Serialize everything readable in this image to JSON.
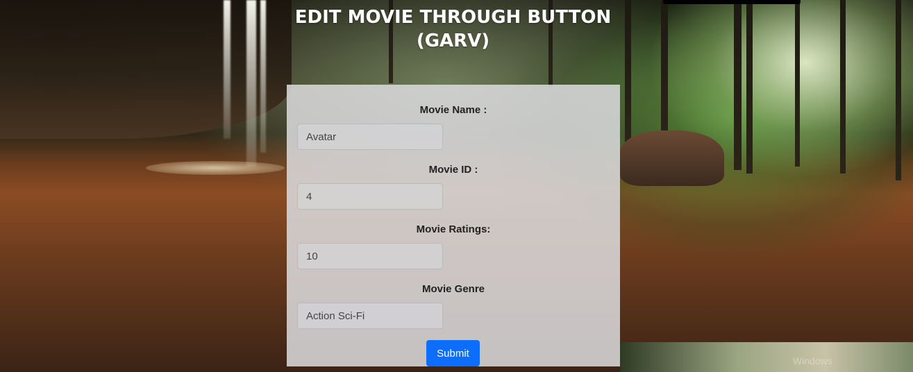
{
  "page": {
    "title": "EDIT MOVIE THROUGH BUTTON\n(GARV)",
    "watermark": "Windows"
  },
  "form": {
    "fields": [
      {
        "label": "Movie Name :",
        "value": "Avatar"
      },
      {
        "label": "Movie ID :",
        "value": "4"
      },
      {
        "label": "Movie Ratings:",
        "value": "10"
      },
      {
        "label": "Movie Genre",
        "value": "Action Sci-Fi"
      }
    ],
    "submit_label": "Submit"
  },
  "colors": {
    "submit_button": "#0d6efd",
    "card_background": "#dcdcde",
    "title_text": "#ffffff"
  }
}
